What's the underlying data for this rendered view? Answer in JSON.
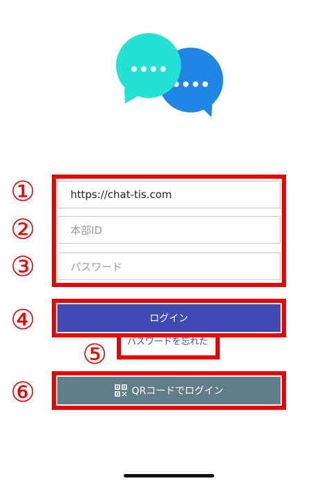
{
  "form": {
    "server_url_value": "https://chat-tis.com",
    "branch_id_placeholder": "本部ID",
    "password_placeholder": "パスワード"
  },
  "buttons": {
    "login_label": "ログイン",
    "forgot_password_label": "パスワードを忘れた",
    "qr_login_label": "QRコードでログイン"
  },
  "annotations": [
    "①",
    "②",
    "③",
    "④",
    "⑤",
    "⑥"
  ],
  "colors": {
    "login_button": "#3f4ab3",
    "qr_button": "#607d88",
    "highlight": "#ee0000",
    "bubble_cyan": "#23e2d4",
    "bubble_blue": "#1f86e6"
  },
  "icons": [
    "chat-bubbles-logo-icon",
    "qr-code-icon"
  ]
}
